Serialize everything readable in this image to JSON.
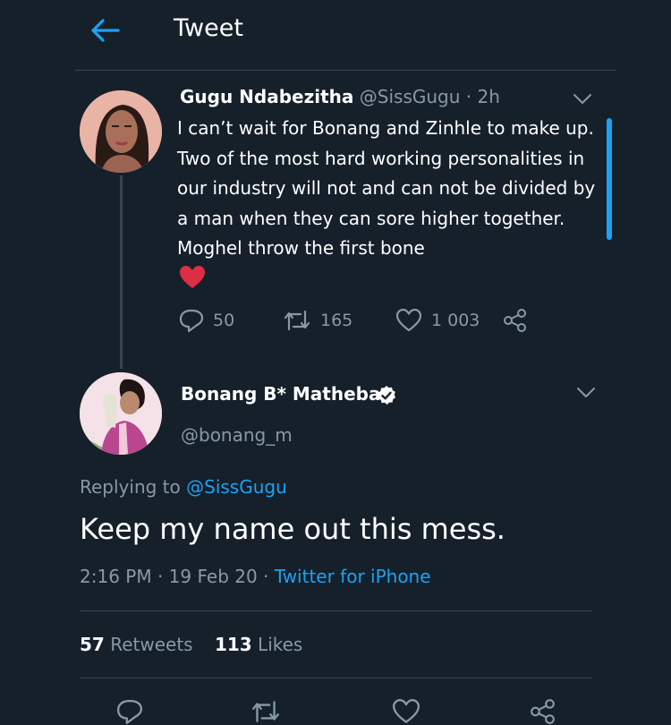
{
  "header": {
    "title": "Tweet"
  },
  "quoted_tweet": {
    "name": "Gugu Ndabezitha",
    "handle": "@SissGugu",
    "separator": " · ",
    "time": "2h",
    "text": "I can’t wait for Bonang and Zinhle to make up. Two of the most hard working personalities in our industry will not and can not be divided by a man when they can sore higher together. Moghel throw the first bone",
    "emoji": "heart",
    "replies": "50",
    "retweets": "165",
    "likes": "1 003"
  },
  "reply_tweet": {
    "name": "Bonang B* Matheba",
    "handle": "@bonang_m",
    "replying_prefix": "Replying to ",
    "replying_to": "@SissGugu",
    "text": "Keep my name out this mess.",
    "time": "2:16 PM",
    "date_sep": " · ",
    "date": "19 Feb 20",
    "source_sep": " · ",
    "source": "Twitter for iPhone",
    "retweets_count": "57",
    "retweets_label": " Retweets",
    "likes_count": "113",
    "likes_label": " Likes"
  },
  "colors": {
    "background": "#15202b",
    "accent": "#1da1f2",
    "muted": "#8899a6",
    "divider": "#38444d",
    "heart": "#e0245e"
  },
  "icons": [
    "back-arrow-icon",
    "chevron-down-icon",
    "reply-icon",
    "retweet-icon",
    "like-icon",
    "share-icon",
    "verified-icon",
    "heart-emoji-icon"
  ]
}
